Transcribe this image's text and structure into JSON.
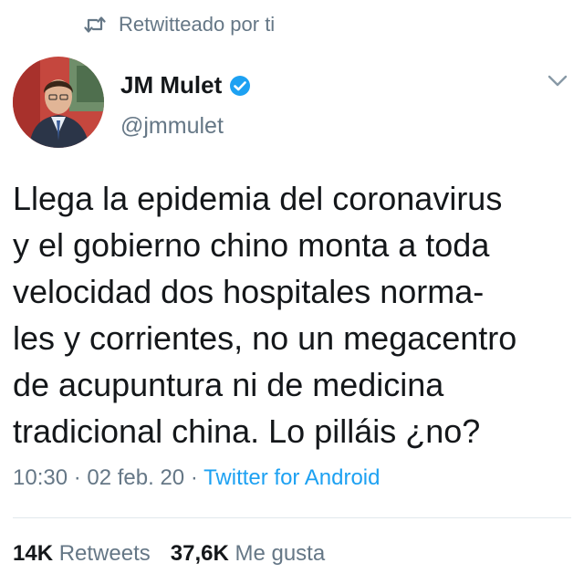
{
  "retweet_banner": {
    "icon": "retweet-icon",
    "label": "Retwitteado por ti"
  },
  "author": {
    "avatar_icon": "avatar",
    "name": "JM Mulet",
    "verified_icon": "verified-badge-icon",
    "handle": "@jmmulet"
  },
  "menu": {
    "icon": "chevron-down-icon"
  },
  "tweet": {
    "lines": [
      "Llega la epidemia del coronavirus",
      "y el gobierno chino monta a toda",
      "velocidad dos hospitales norma-",
      "les y corrientes, no un megacentro",
      "de acupuntura ni de medicina",
      "tradicional china. Lo pilláis ¿no?"
    ]
  },
  "meta": {
    "time": "10:30",
    "separator": " · ",
    "date": "02 feb. 20",
    "source": "Twitter for Android"
  },
  "stats": {
    "retweets_count": "14K",
    "retweets_label": "Retweets",
    "likes_count": "37,6K",
    "likes_label": "Me gusta"
  },
  "colors": {
    "text": "#14171a",
    "secondary": "#657786",
    "accent": "#1da1f2",
    "divider": "#e1e8ed"
  }
}
